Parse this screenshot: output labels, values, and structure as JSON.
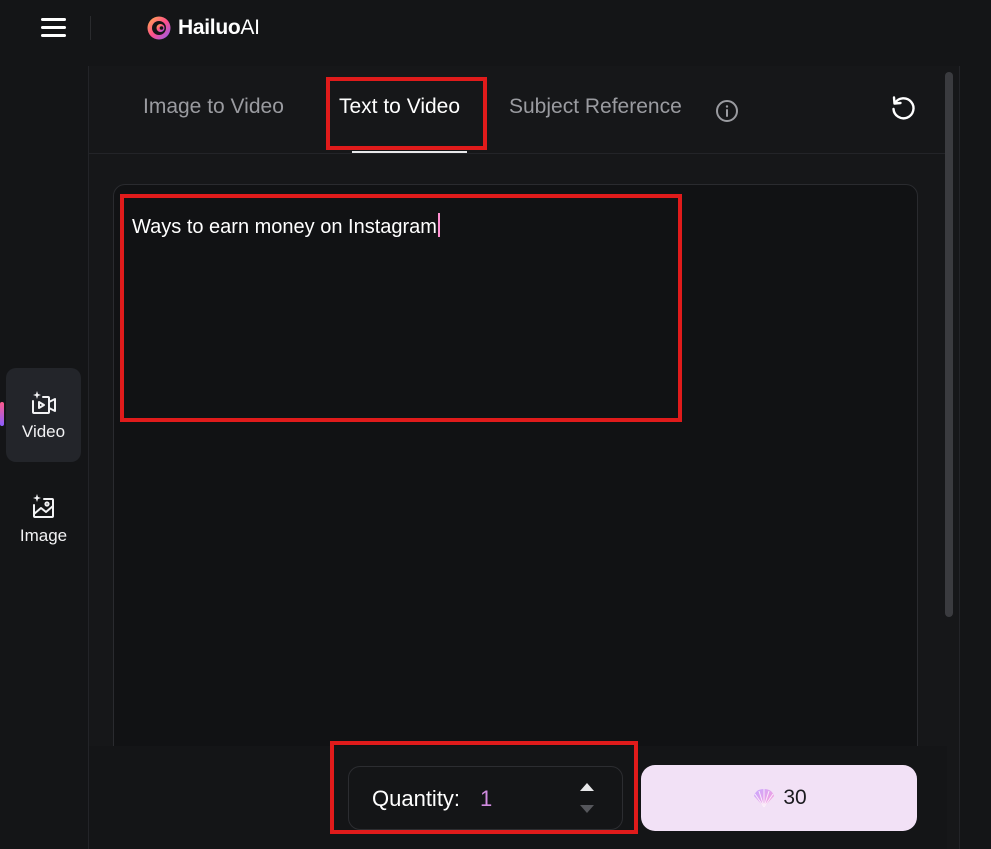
{
  "header": {
    "brand_bold": "Hailuo",
    "brand_light": "AI",
    "menu_icon": "hamburger-menu-icon"
  },
  "sidebar": {
    "items": [
      {
        "label": "Video",
        "icon": "video-sparkle-icon",
        "active": true
      },
      {
        "label": "Image",
        "icon": "image-sparkle-icon",
        "active": false
      }
    ]
  },
  "tabs": {
    "items": [
      {
        "label": "Image to Video",
        "active": false
      },
      {
        "label": "Text to Video",
        "active": true
      },
      {
        "label": "Subject Reference",
        "active": false
      }
    ],
    "info_icon": "info-icon",
    "refresh_icon": "refresh-icon"
  },
  "prompt": {
    "value": "Ways to earn money on Instagram"
  },
  "quantity": {
    "label": "Quantity:",
    "value": "1"
  },
  "generate": {
    "icon": "shell-credit-icon",
    "cost": "30"
  },
  "colors": {
    "highlight": "#e01b1b",
    "accent": "#d18be0",
    "generate_bg": "#f2e1f6"
  }
}
